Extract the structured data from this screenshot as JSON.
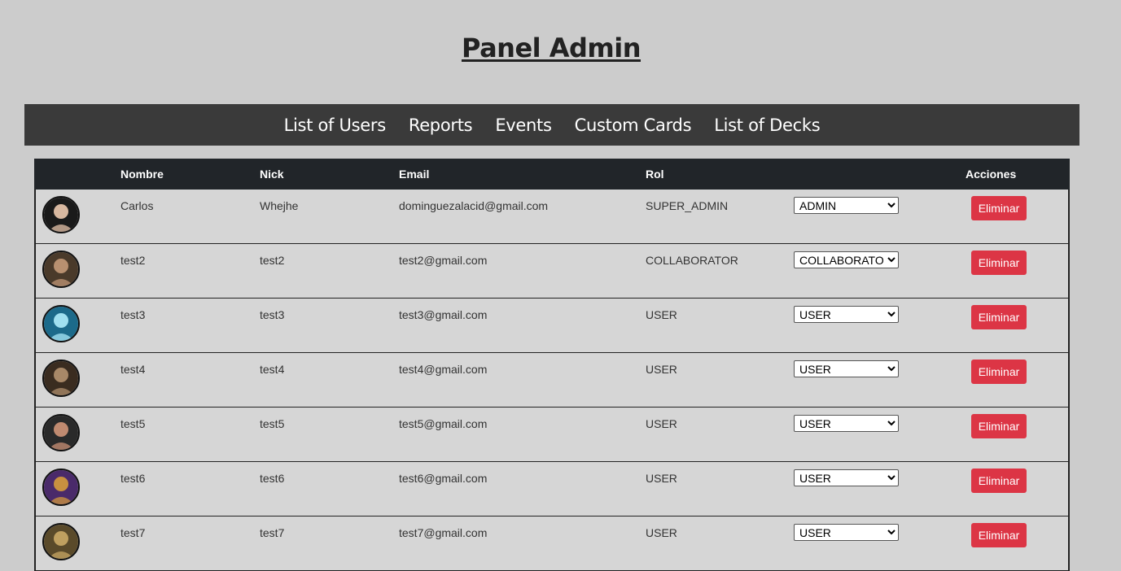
{
  "page_title": "Panel Admin",
  "nav": [
    "List of Users",
    "Reports",
    "Events",
    "Custom Cards",
    "List of Decks"
  ],
  "table": {
    "headers": {
      "name": "Nombre",
      "nick": "Nick",
      "email": "Email",
      "role": "Rol",
      "actions": "Acciones"
    },
    "delete_label": "Eliminar",
    "role_options": [
      "SUPER_ADMIN",
      "ADMIN",
      "COLLABORATOR",
      "USER"
    ],
    "rows": [
      {
        "name": "Carlos",
        "nick": "Whejhe",
        "email": "dominguezalacid@gmail.com",
        "role": "SUPER_ADMIN",
        "selected_role": "ADMIN"
      },
      {
        "name": "test2",
        "nick": "test2",
        "email": "test2@gmail.com",
        "role": "COLLABORATOR",
        "selected_role": "COLLABORATOR"
      },
      {
        "name": "test3",
        "nick": "test3",
        "email": "test3@gmail.com",
        "role": "USER",
        "selected_role": "USER"
      },
      {
        "name": "test4",
        "nick": "test4",
        "email": "test4@gmail.com",
        "role": "USER",
        "selected_role": "USER"
      },
      {
        "name": "test5",
        "nick": "test5",
        "email": "test5@gmail.com",
        "role": "USER",
        "selected_role": "USER"
      },
      {
        "name": "test6",
        "nick": "test6",
        "email": "test6@gmail.com",
        "role": "USER",
        "selected_role": "USER"
      },
      {
        "name": "test7",
        "nick": "test7",
        "email": "test7@gmail.com",
        "role": "USER",
        "selected_role": "USER"
      }
    ]
  },
  "colors": {
    "background": "#cccccc",
    "navbar": "#3a3a3a",
    "table_header": "#212529",
    "row": "#d6d6d6",
    "danger": "#dc3545"
  },
  "avatar_colors": [
    [
      "#1a1a1a",
      "#d8b8a0"
    ],
    [
      "#4a3a2a",
      "#b89070"
    ],
    [
      "#1c6a8a",
      "#a0e0f0"
    ],
    [
      "#3a2c20",
      "#a88868"
    ],
    [
      "#2a2a2a",
      "#c08a70"
    ],
    [
      "#4a2a6a",
      "#c89040"
    ],
    [
      "#5a4a2a",
      "#c0a060"
    ]
  ]
}
